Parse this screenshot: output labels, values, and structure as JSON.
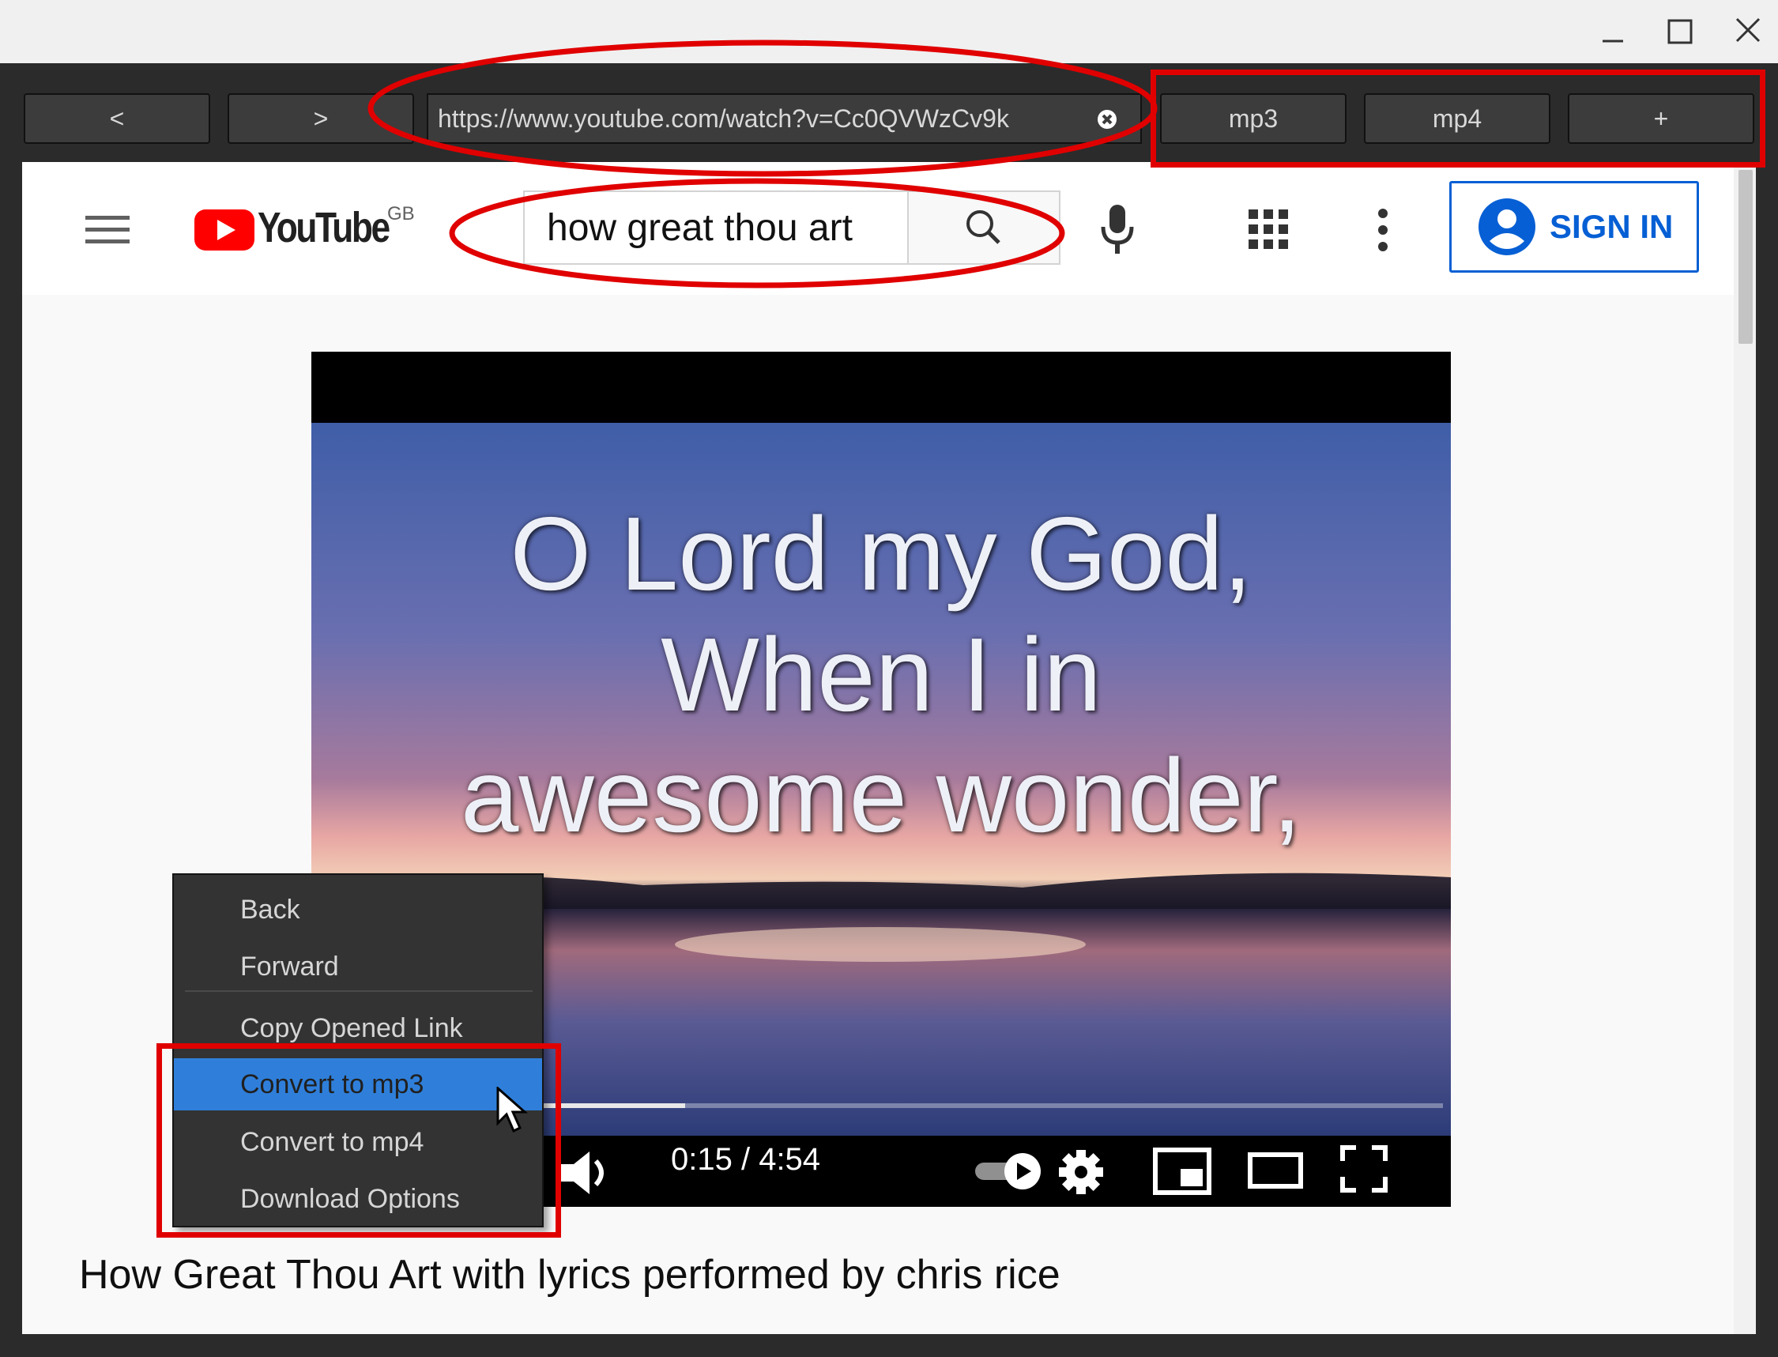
{
  "toolbar": {
    "back_label": "<",
    "forward_label": ">",
    "url": "https://www.youtube.com/watch?v=Cc0QVWzCv9k",
    "mp3_label": "mp3",
    "mp4_label": "mp4",
    "add_label": "+"
  },
  "youtube": {
    "logo_text": "YouTube",
    "region": "GB",
    "search_value": "how great thou art",
    "sign_in_label": "SIGN IN"
  },
  "video": {
    "lyrics": [
      "O Lord my God,",
      "When I in",
      "awesome wonder,"
    ],
    "time": "0:15 / 4:54",
    "progress": 0.33,
    "title": "How Great Thou Art with lyrics performed by chris rice"
  },
  "context_menu": {
    "items": [
      "Back",
      "Forward",
      "Copy Opened Link",
      "Convert to mp3",
      "Convert to mp4",
      "Download Options"
    ],
    "selected": "Convert to mp3"
  },
  "colors": {
    "annotation": "#e00000",
    "youtube_red": "#ff0000",
    "selection": "#2f7fda",
    "link_blue": "#065fd4"
  },
  "icons": [
    "minimize-icon",
    "maximize-icon",
    "close-icon",
    "clear-icon",
    "hamburger-menu-icon",
    "youtube-logo-icon",
    "search-icon",
    "microphone-icon",
    "apps-grid-icon",
    "more-vert-icon",
    "account-icon",
    "volume-icon",
    "autoplay-toggle-icon",
    "settings-gear-icon",
    "miniplayer-icon",
    "theater-mode-icon",
    "fullscreen-icon",
    "mouse-cursor-icon"
  ]
}
